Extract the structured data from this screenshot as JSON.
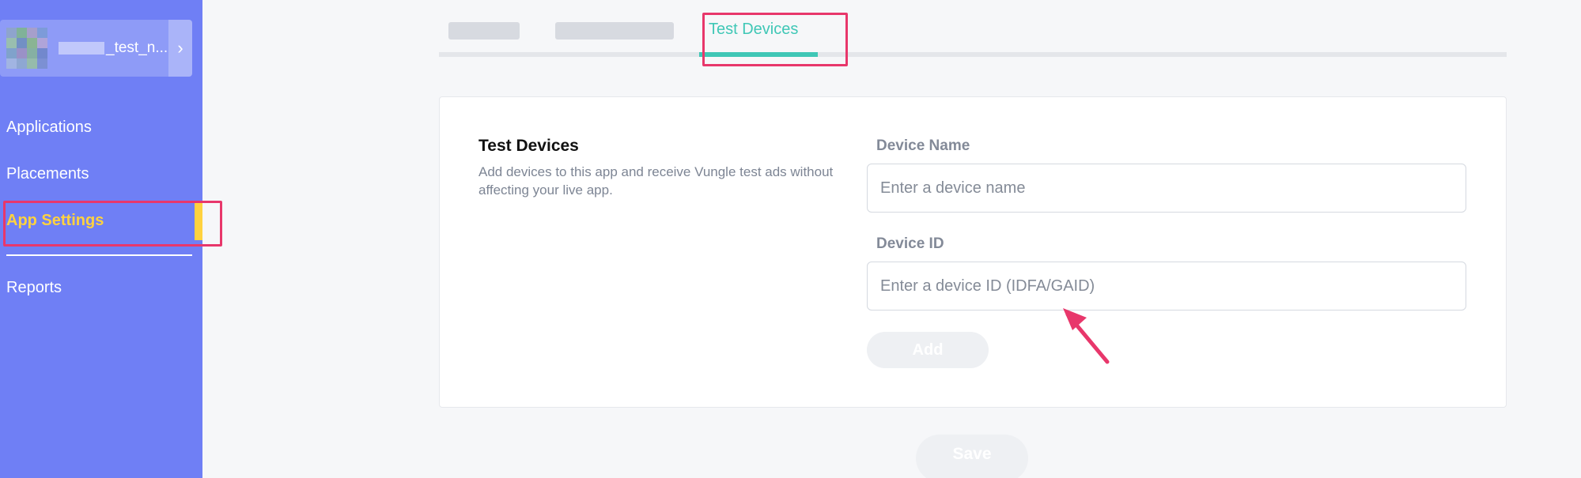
{
  "sidebar": {
    "app_name": "_test_n...",
    "chevron": "›",
    "items": [
      {
        "label": "Applications"
      },
      {
        "label": "Placements"
      },
      {
        "label": "App Settings"
      },
      {
        "label": "Reports"
      }
    ],
    "active_color": "#ffd23f",
    "background": "#6f7ff5"
  },
  "tabs": {
    "active_label": "Test Devices",
    "accent": "#3fc7b6"
  },
  "test_devices": {
    "title": "Test Devices",
    "description": "Add devices to this app and receive Vungle test ads without affecting your live app.",
    "device_name": {
      "label": "Device Name",
      "placeholder": "Enter a device name"
    },
    "device_id": {
      "label": "Device ID",
      "placeholder": "Enter a device ID (IDFA/GAID)"
    },
    "add_label": "Add"
  },
  "footer": {
    "save_label": "Save"
  },
  "annotation_color": "#e8376b"
}
